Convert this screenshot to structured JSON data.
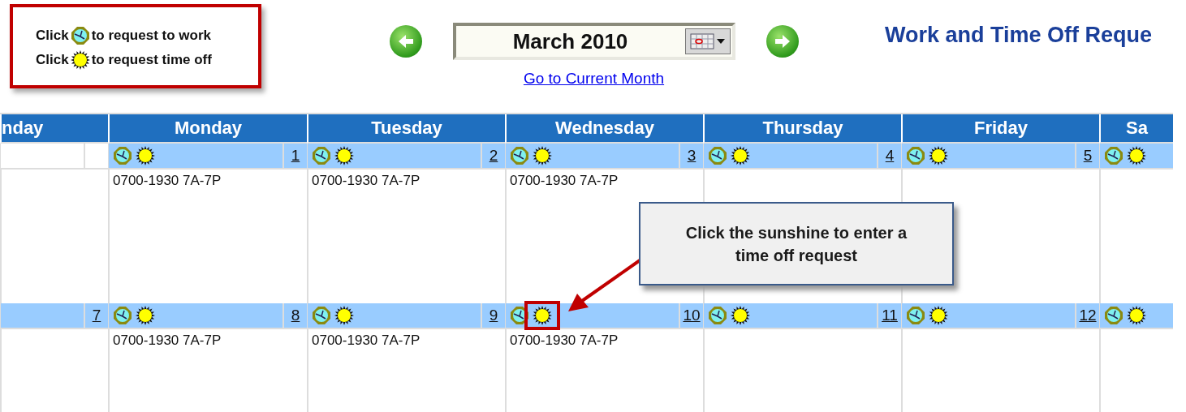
{
  "legend": {
    "lines": [
      {
        "kind": "work",
        "before": "Click",
        "after": "to request to work"
      },
      {
        "kind": "time_off",
        "before": "Click",
        "after": "to request time off"
      }
    ]
  },
  "nav": {
    "month": "March 2010",
    "current_link": "Go to Current Month"
  },
  "title": "Work and Time Off Reque",
  "calendar": {
    "days": [
      "nday",
      "Monday",
      "Tuesday",
      "Wednesday",
      "Thursday",
      "Friday",
      "Sa"
    ],
    "weeks": [
      {
        "cells": [
          {
            "icons": false,
            "highlighted": false
          },
          {
            "icons": true,
            "date": "1",
            "shift": "0700-1930 7A-7P",
            "highlighted": false
          },
          {
            "icons": true,
            "date": "2",
            "shift": "0700-1930 7A-7P",
            "highlighted": false
          },
          {
            "icons": true,
            "date": "3",
            "shift": "0700-1930 7A-7P",
            "highlighted": false
          },
          {
            "icons": true,
            "date": "4",
            "highlighted": false
          },
          {
            "icons": true,
            "date": "5",
            "highlighted": false
          },
          {
            "icons": true,
            "highlighted": false
          }
        ]
      },
      {
        "cells": [
          {
            "icons": false,
            "date": "7",
            "highlighted": false
          },
          {
            "icons": true,
            "date": "8",
            "shift": "0700-1930 7A-7P",
            "highlighted": false
          },
          {
            "icons": true,
            "date": "9",
            "shift": "0700-1930 7A-7P",
            "highlighted": false
          },
          {
            "icons": true,
            "date": "10",
            "shift": "0700-1930 7A-7P",
            "highlighted": true
          },
          {
            "icons": true,
            "date": "11",
            "highlighted": false
          },
          {
            "icons": true,
            "date": "12",
            "highlighted": false
          },
          {
            "icons": true,
            "highlighted": false
          }
        ]
      }
    ]
  },
  "callout": {
    "text": "Click the sunshine to enter a time off request"
  }
}
